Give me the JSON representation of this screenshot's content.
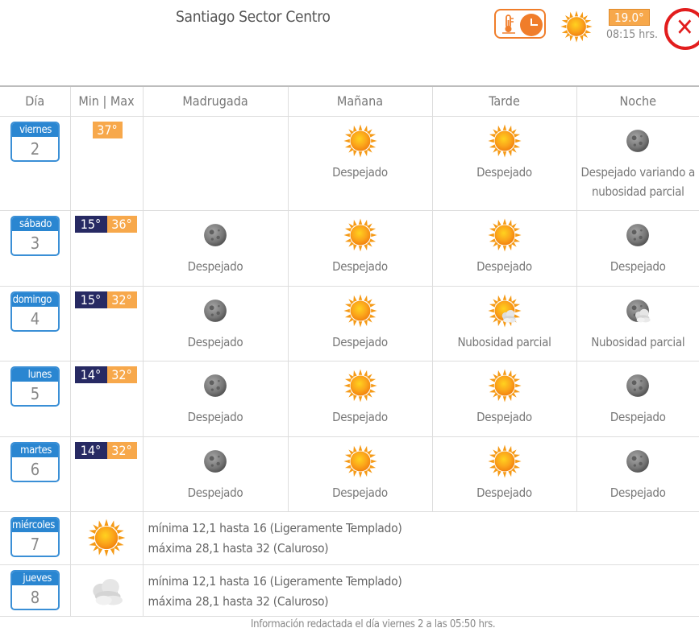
{
  "header": {
    "title": "Santiago Sector Centro",
    "current_temp": "19.0°",
    "current_time": "08:15 hrs.",
    "current_icon": "sun-icon",
    "close_icon": "close-icon"
  },
  "columns": [
    "Día",
    "Min | Max",
    "Madrugada",
    "Mañana",
    "Tarde",
    "Noche"
  ],
  "days": [
    {
      "name": "viernes",
      "num": "2",
      "min": "",
      "max": "37°",
      "periods": [
        {
          "icon": "none",
          "label": ""
        },
        {
          "icon": "sun",
          "label": "Despejado"
        },
        {
          "icon": "sun",
          "label": "Despejado"
        },
        {
          "icon": "moon",
          "label": "Despejado variando a nubosidad parcial"
        }
      ]
    },
    {
      "name": "sábado",
      "num": "3",
      "min": "15°",
      "max": "36°",
      "periods": [
        {
          "icon": "moon",
          "label": "Despejado"
        },
        {
          "icon": "sun",
          "label": "Despejado"
        },
        {
          "icon": "sun",
          "label": "Despejado"
        },
        {
          "icon": "moon",
          "label": "Despejado"
        }
      ]
    },
    {
      "name": "domingo",
      "num": "4",
      "min": "15°",
      "max": "32°",
      "periods": [
        {
          "icon": "moon",
          "label": "Despejado"
        },
        {
          "icon": "sun",
          "label": "Despejado"
        },
        {
          "icon": "sun-cloud",
          "label": "Nubosidad parcial"
        },
        {
          "icon": "moon-cloud",
          "label": "Nubosidad parcial"
        }
      ]
    },
    {
      "name": "lunes",
      "num": "5",
      "min": "14°",
      "max": "32°",
      "periods": [
        {
          "icon": "moon",
          "label": "Despejado"
        },
        {
          "icon": "sun",
          "label": "Despejado"
        },
        {
          "icon": "sun",
          "label": "Despejado"
        },
        {
          "icon": "moon",
          "label": "Despejado"
        }
      ]
    },
    {
      "name": "martes",
      "num": "6",
      "min": "14°",
      "max": "32°",
      "periods": [
        {
          "icon": "moon",
          "label": "Despejado"
        },
        {
          "icon": "sun",
          "label": "Despejado"
        },
        {
          "icon": "sun",
          "label": "Despejado"
        },
        {
          "icon": "moon",
          "label": "Despejado"
        }
      ]
    }
  ],
  "extended": [
    {
      "name": "miércoles",
      "num": "7",
      "icon": "sun",
      "min_text": "mínima 12,1 hasta 16 (Ligeramente Templado)",
      "max_text": "máxima 28,1 hasta 32 (Caluroso)"
    },
    {
      "name": "jueves",
      "num": "8",
      "icon": "cloud",
      "min_text": "mínima 12,1 hasta 16 (Ligeramente Templado)",
      "max_text": "máxima 28,1 hasta 32 (Caluroso)"
    }
  ],
  "footer": "Información redactada el día viernes 2 a las 05:50 hrs."
}
